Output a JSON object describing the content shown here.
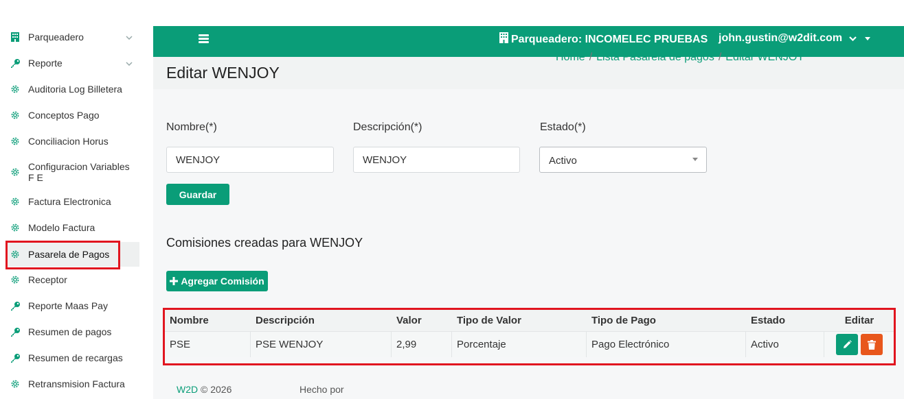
{
  "sidebar": {
    "items": [
      {
        "label": "Parqueadero",
        "icon": "building-icon",
        "chevron": true
      },
      {
        "label": "Reporte",
        "icon": "key-icon",
        "chevron": true
      },
      {
        "label": "Auditoria Log Billetera",
        "icon": "gear-icon"
      },
      {
        "label": "Conceptos Pago",
        "icon": "gear-icon"
      },
      {
        "label": "Conciliacion Horus",
        "icon": "gear-icon"
      },
      {
        "label": "Configuracion Variables F E",
        "icon": "gear-icon"
      },
      {
        "label": "Factura Electronica",
        "icon": "gear-icon"
      },
      {
        "label": "Modelo Factura",
        "icon": "gear-icon"
      },
      {
        "label": "Pasarela de Pagos",
        "icon": "gear-icon",
        "active": true
      },
      {
        "label": "Receptor",
        "icon": "gear-icon"
      },
      {
        "label": "Reporte Maas Pay",
        "icon": "key-icon"
      },
      {
        "label": "Resumen de pagos",
        "icon": "key-icon"
      },
      {
        "label": "Resumen de recargas",
        "icon": "key-icon"
      },
      {
        "label": "Retransmision Factura",
        "icon": "gear-icon"
      }
    ]
  },
  "topbar": {
    "parking": "Parqueadero: INCOMELEC PRUEBAS",
    "user": "john.gustin@w2dit.com"
  },
  "header": {
    "title": "Editar WENJOY",
    "breadcrumbs": [
      "Home",
      "Lista Pasarela de pagos",
      "Editar WENJOY"
    ]
  },
  "form": {
    "nombre_label": "Nombre",
    "descripcion_label": "Descripción",
    "estado_label": "Estado",
    "required_mark": "(*)",
    "nombre_value": "WENJOY",
    "descripcion_value": "WENJOY",
    "estado_value": "Activo",
    "save_label": "Guardar"
  },
  "commissions": {
    "title": "Comisiones creadas para WENJOY",
    "add_label": "Agregar Comisión",
    "columns": [
      "Nombre",
      "Descripción",
      "Valor",
      "Tipo de Valor",
      "Tipo de Pago",
      "Estado",
      "Editar"
    ],
    "rows": [
      [
        "PSE",
        "PSE WENJOY",
        "2,99",
        "Porcentaje",
        "Pago Electrónico",
        "Activo"
      ]
    ]
  },
  "footer": {
    "brand": "W2D",
    "copyright": "© 2026",
    "made_by": "Hecho por"
  },
  "colors": {
    "primary": "#0a9d78",
    "danger": "#e8571c",
    "highlight": "#e1151f"
  }
}
